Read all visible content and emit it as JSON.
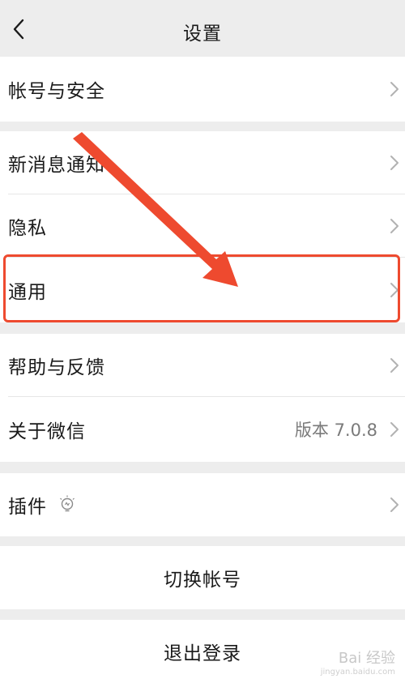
{
  "nav": {
    "title": "设置"
  },
  "groups": [
    {
      "items": [
        {
          "label": "帐号与安全"
        }
      ]
    },
    {
      "items": [
        {
          "label": "新消息通知"
        },
        {
          "label": "隐私"
        },
        {
          "label": "通用"
        }
      ]
    },
    {
      "items": [
        {
          "label": "帮助与反馈"
        },
        {
          "label": "关于微信",
          "value": "版本 7.0.8"
        }
      ]
    },
    {
      "items": [
        {
          "label": "插件",
          "icon": "lightbulb-icon"
        }
      ]
    }
  ],
  "actions": {
    "switch_account": "切换帐号",
    "logout": "退出登录"
  },
  "watermark": {
    "brand": "Bai 经验",
    "url": "jingyan.baidu.com"
  },
  "colors": {
    "background": "#ededed",
    "highlight": "#ee4a2f",
    "arrow": "#ee4a2f"
  }
}
